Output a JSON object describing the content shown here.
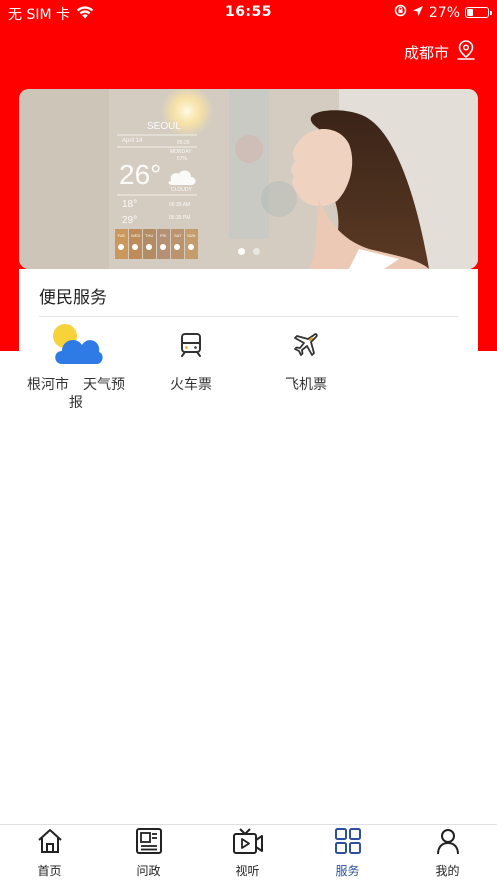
{
  "status_bar": {
    "carrier": "无 SIM 卡",
    "time": "16:55",
    "battery": "27%"
  },
  "header": {
    "city": "成都市",
    "bg_color": "#ff0000"
  },
  "banner": {
    "weather_overlay": {
      "city": "SEOUL",
      "date": "April 14",
      "time": "05:20",
      "day": "MONDAY",
      "humidity": "57%",
      "temperature": "26°",
      "condition": "CLOUDY",
      "low": "18°",
      "high": "29°",
      "sunrise": "06:35 AM",
      "sunset": "05:35 PM",
      "week": [
        "TUE",
        "WED",
        "THU",
        "FRI",
        "SAT",
        "SUN"
      ]
    },
    "slide_count": 2,
    "active_slide": 1
  },
  "services": {
    "title": "便民服务",
    "items": [
      {
        "label": "根河市　天气预报",
        "icon": "weather-icon"
      },
      {
        "label": "火车票",
        "icon": "train-icon"
      },
      {
        "label": "飞机票",
        "icon": "airplane-icon"
      }
    ]
  },
  "tabbar": {
    "active_color": "#2c4f9e",
    "items": [
      {
        "label": "首页",
        "icon": "home-icon"
      },
      {
        "label": "问政",
        "icon": "news-icon"
      },
      {
        "label": "视听",
        "icon": "tv-icon"
      },
      {
        "label": "服务",
        "icon": "grid-icon"
      },
      {
        "label": "我的",
        "icon": "user-icon"
      }
    ],
    "active_index": 3
  }
}
